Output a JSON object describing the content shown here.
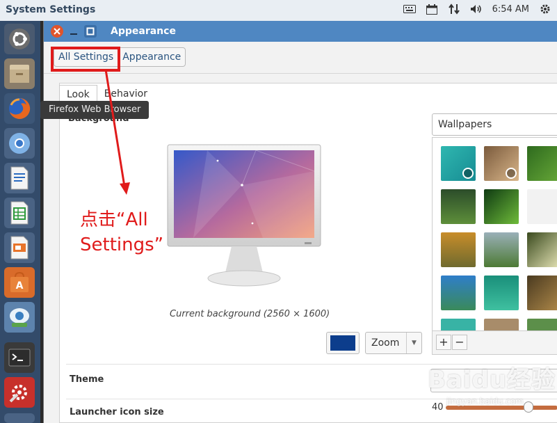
{
  "panel": {
    "title": "System Settings",
    "time": "6:54 AM"
  },
  "launcher": {
    "tooltip": "Firefox Web Browser",
    "items": [
      "ubuntu-dash-icon",
      "files-icon",
      "firefox-icon",
      "chromium-icon",
      "writer-icon",
      "calc-icon",
      "impress-icon",
      "software-center-icon",
      "remmina-icon",
      "terminal-icon",
      "system-settings-icon"
    ]
  },
  "window": {
    "title": "Appearance",
    "breadcrumb": [
      "All Settings",
      "Appearance"
    ],
    "tabs": [
      "Look",
      "Behavior"
    ],
    "background_label": "Background",
    "caption": "Current background (2560 × 1600)",
    "zoom_value": "Zoom",
    "wallpaper_source": "Wallpapers",
    "theme_label": "Theme",
    "icon_size_label": "Launcher icon size",
    "icon_size_value": "40",
    "add_button": "+",
    "remove_button": "−",
    "background_color": "#0c3d8c"
  },
  "annotation": {
    "line1": "点击“All",
    "line2": "Settings”"
  },
  "watermark": {
    "text": "Baidu经验",
    "sub": "jingyan.baidu.com"
  }
}
